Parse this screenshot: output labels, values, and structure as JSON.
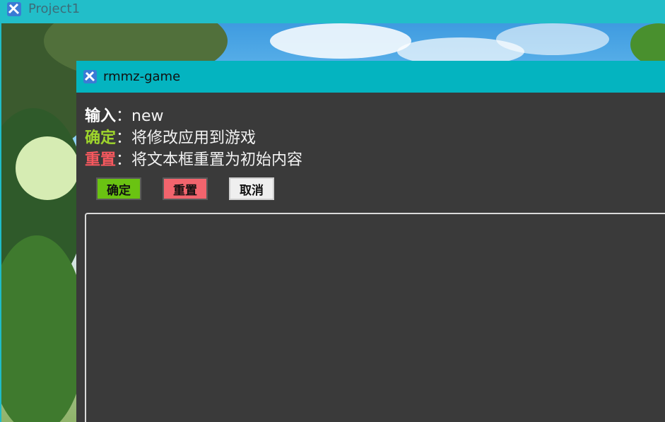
{
  "outer_window": {
    "title": "Project1"
  },
  "dialog": {
    "title": "rmmz-game",
    "input_line": {
      "label": "输入",
      "sep": "：",
      "value": "new"
    },
    "confirm_line": {
      "label": "确定",
      "sep": "：",
      "text": "将修改应用到游戏"
    },
    "reset_line": {
      "label": "重置",
      "sep": "：",
      "text": "将文本框重置为初始内容"
    },
    "buttons": {
      "confirm": "确定",
      "reset": "重置",
      "cancel": "取消"
    },
    "textarea_value": ""
  },
  "colors": {
    "titlebar": "#04b4c0",
    "panel": "#3a3a3a",
    "confirm": "#6ac312",
    "reset": "#f2646d",
    "cancel": "#efefef"
  },
  "icons": {
    "app_icon": "rpg-maker-icon"
  }
}
